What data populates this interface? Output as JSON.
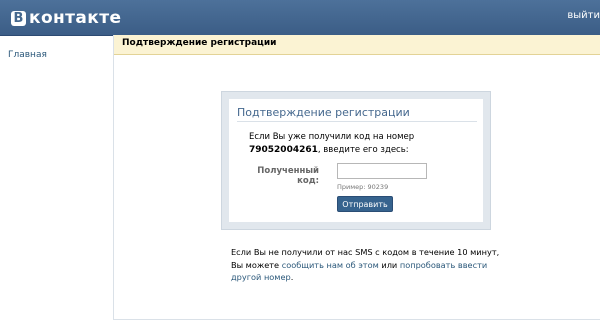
{
  "header": {
    "logo_letter": "В",
    "logo_text": "контакте",
    "logout_label": "выйти"
  },
  "nav": {
    "home_label": "Главная"
  },
  "content": {
    "header_title": "Подтверждение регистрации"
  },
  "form": {
    "title": "Подтверждение регистрации",
    "intro_line1": "Если Вы уже получили код на номер",
    "phone_number": "79052004261",
    "intro_line2": ", введите его здесь:",
    "code_label": "Полученный код:",
    "code_value": "",
    "code_placeholder": "",
    "example_text": "Пример: 90239",
    "submit_label": "Отправить"
  },
  "note": {
    "text_part1": "Если Вы не получили от нас SMS с кодом в течение 10 минут, Вы можете ",
    "link_report": "сообщить нам об этом",
    "text_or": " или ",
    "link_retry": "попробовать ввести другой номер",
    "text_end": "."
  },
  "colors": {
    "header_bg": "#45688e",
    "link": "#2b587a",
    "content_header_bg": "#fbf3d3",
    "button_bg": "#36638e"
  }
}
